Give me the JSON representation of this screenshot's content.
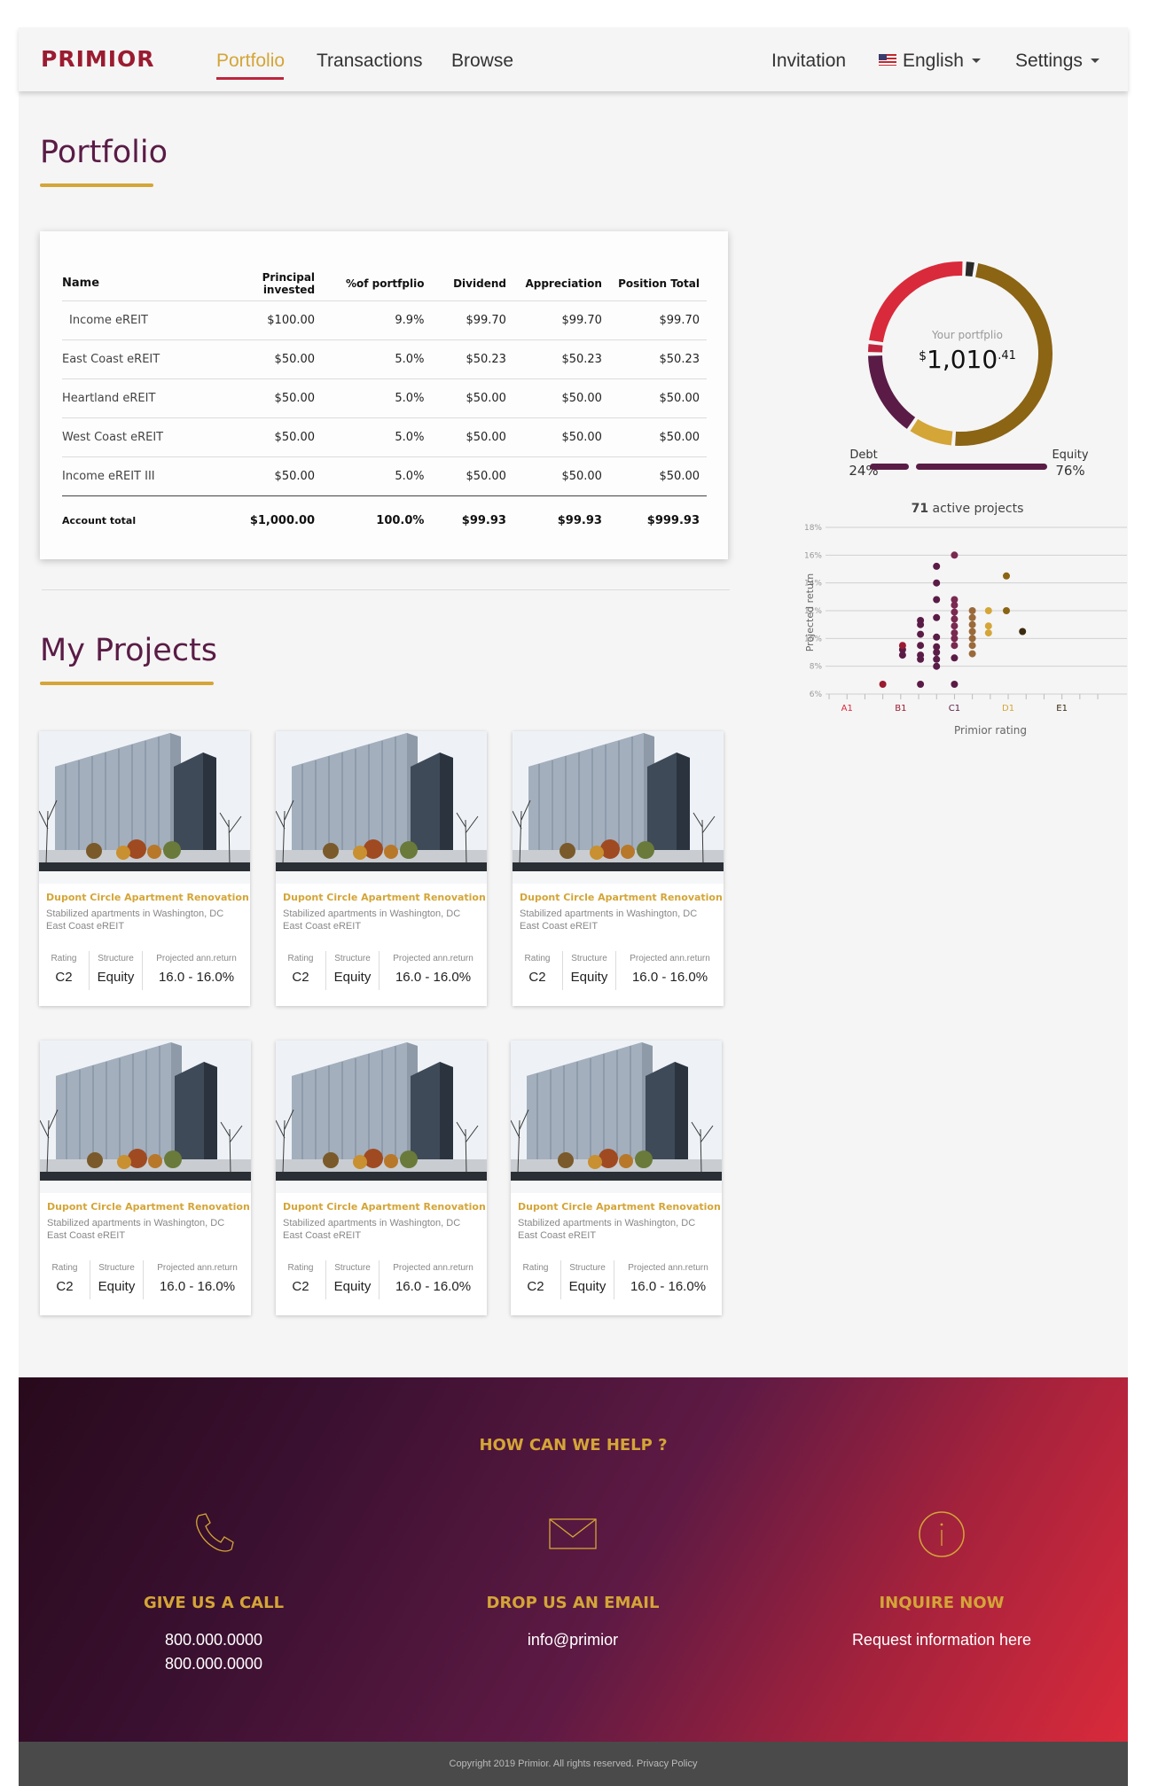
{
  "nav": {
    "logo": "PRIMIOR",
    "links": [
      "Portfolio",
      "Transactions",
      "Browse"
    ],
    "invitation": "Invitation",
    "language": "English",
    "settings": "Settings"
  },
  "portfolio": {
    "title": "Portfolio",
    "columns": [
      "Name",
      "Principal invested",
      "%of portfplio",
      "Dividend",
      "Appreciation",
      "Position Total"
    ],
    "rows": [
      [
        "Income eREIT",
        "$100.00",
        "9.9%",
        "$99.70",
        "$99.70",
        "$99.70"
      ],
      [
        "East Coast eREIT",
        "$50.00",
        "5.0%",
        "$50.23",
        "$50.23",
        "$50.23"
      ],
      [
        "Heartland eREIT",
        "$50.00",
        "5.0%",
        "$50.00",
        "$50.00",
        "$50.00"
      ],
      [
        "West Coast eREIT",
        "$50.00",
        "5.0%",
        "$50.00",
        "$50.00",
        "$50.00"
      ],
      [
        "Income eREIT III",
        "$50.00",
        "5.0%",
        "$50.00",
        "$50.00",
        "$50.00"
      ]
    ],
    "total": [
      "Account total",
      "$1,000.00",
      "100.0%",
      "$99.93",
      "$99.93",
      "$999.93"
    ]
  },
  "summary": {
    "label": "Your portfplio",
    "dollar_sign": "$",
    "amount": "1,010",
    "cents": ".41",
    "debt_label": "Debt",
    "debt_pct": "24%",
    "equity_label": "Equity",
    "equity_pct": "76%",
    "active_count": "71",
    "active_text": "active projects"
  },
  "projects": {
    "title": "My Projects",
    "cards": [
      {
        "title": "Dupont Circle Apartment Renovation",
        "desc": "Stabilized apartments in Washington, DC East Coast eREIT",
        "rating_label": "Rating",
        "rating": "C2",
        "structure_label": "Structure",
        "structure": "Equity",
        "return_label": "Projected ann.return",
        "return": "16.0 - 16.0%"
      },
      {
        "title": "Dupont Circle Apartment Renovation",
        "desc": "Stabilized apartments in Washington, DC East Coast eREIT",
        "rating_label": "Rating",
        "rating": "C2",
        "structure_label": "Structure",
        "structure": "Equity",
        "return_label": "Projected ann.return",
        "return": "16.0 - 16.0%"
      },
      {
        "title": "Dupont Circle Apartment Renovation",
        "desc": "Stabilized apartments in Washington, DC East Coast eREIT",
        "rating_label": "Rating",
        "rating": "C2",
        "structure_label": "Structure",
        "structure": "Equity",
        "return_label": "Projected ann.return",
        "return": "16.0 - 16.0%"
      },
      {
        "title": "Dupont Circle Apartment Renovation",
        "desc": "Stabilized apartments in Washington, DC East Coast eREIT",
        "rating_label": "Rating",
        "rating": "C2",
        "structure_label": "Structure",
        "structure": "Equity",
        "return_label": "Projected ann.return",
        "return": "16.0 - 16.0%"
      },
      {
        "title": "Dupont Circle Apartment Renovation",
        "desc": "Stabilized apartments in Washington, DC East Coast eREIT",
        "rating_label": "Rating",
        "rating": "C2",
        "structure_label": "Structure",
        "structure": "Equity",
        "return_label": "Projected ann.return",
        "return": "16.0 - 16.0%"
      },
      {
        "title": "Dupont Circle Apartment Renovation",
        "desc": "Stabilized apartments in Washington, DC East Coast eREIT",
        "rating_label": "Rating",
        "rating": "C2",
        "structure_label": "Structure",
        "structure": "Equity",
        "return_label": "Projected ann.return",
        "return": "16.0 - 16.0%"
      }
    ]
  },
  "footer": {
    "heading": "HOW CAN WE HELP ?",
    "call_title": "GIVE US A CALL",
    "phone1": "800.000.0000",
    "phone2": "800.000.0000",
    "email_title": "DROP US AN EMAIL",
    "email": "info@primior",
    "inquire_title": "INQUIRE NOW",
    "inquire_text": "Request information here",
    "copyright": "Copyright 2019 Primior. All rights reserved. Privacy Policy"
  },
  "colors": {
    "brand": "#9b1b30",
    "gold": "#d4a537",
    "plum": "#5a1c46",
    "red": "#d92a3b",
    "brown": "#8b6414",
    "dark": "#2a2a2a"
  },
  "chart_data": [
    {
      "type": "pie",
      "variant": "donut",
      "slices": [
        {
          "color": "#8b6414",
          "value": 47
        },
        {
          "color": "#d4a537",
          "value": 8
        },
        {
          "color": "#5a1c46",
          "value": 15
        },
        {
          "color": "#c0253e",
          "value": 2
        },
        {
          "color": "#d92a3b",
          "value": 23
        },
        {
          "color": "#2a2a2a",
          "value": 2
        }
      ]
    },
    {
      "type": "bar",
      "orientation": "horizontal",
      "categories": [
        "Debt",
        "Equity"
      ],
      "values": [
        24,
        76
      ]
    },
    {
      "type": "scatter",
      "title": "71 active projects",
      "xlabel": "Primior rating",
      "ylabel": "Projected return",
      "x_ticks": [
        "A1",
        "B1",
        "C1",
        "D1",
        "E1"
      ],
      "y_ticks": [
        "6%",
        "8%",
        "10%",
        "12%",
        "14%",
        "16%",
        "18%"
      ],
      "ylim": [
        6,
        18
      ],
      "grid": true,
      "points": [
        {
          "x": 3.2,
          "y": 6.7,
          "color": "#9b1b30"
        },
        {
          "x": 5.3,
          "y": 6.7,
          "color": "#5a1c46"
        },
        {
          "x": 7.2,
          "y": 6.7,
          "color": "#5a1c46"
        },
        {
          "x": 4.3,
          "y": 8.8,
          "color": "#5a1c46"
        },
        {
          "x": 4.3,
          "y": 9.2,
          "color": "#5a1c46"
        },
        {
          "x": 4.3,
          "y": 9.5,
          "color": "#9b1b30"
        },
        {
          "x": 5.3,
          "y": 8.5,
          "color": "#5a1c46"
        },
        {
          "x": 5.3,
          "y": 8.8,
          "color": "#5a1c46"
        },
        {
          "x": 5.3,
          "y": 9.5,
          "color": "#5a1c46"
        },
        {
          "x": 5.3,
          "y": 10.3,
          "color": "#5a1c46"
        },
        {
          "x": 5.3,
          "y": 11.0,
          "color": "#5a1c46"
        },
        {
          "x": 5.3,
          "y": 11.3,
          "color": "#5a1c46"
        },
        {
          "x": 6.2,
          "y": 8.0,
          "color": "#5a1c46"
        },
        {
          "x": 6.2,
          "y": 8.5,
          "color": "#5a1c46"
        },
        {
          "x": 6.2,
          "y": 9.0,
          "color": "#5a1c46"
        },
        {
          "x": 6.2,
          "y": 9.4,
          "color": "#5a1c46"
        },
        {
          "x": 6.2,
          "y": 10.1,
          "color": "#5a1c46"
        },
        {
          "x": 6.2,
          "y": 11.5,
          "color": "#5a1c46"
        },
        {
          "x": 6.2,
          "y": 12.8,
          "color": "#5a1c46"
        },
        {
          "x": 6.2,
          "y": 14.0,
          "color": "#5a1c46"
        },
        {
          "x": 6.2,
          "y": 15.2,
          "color": "#5a1c46"
        },
        {
          "x": 7.2,
          "y": 8.6,
          "color": "#5a1c46"
        },
        {
          "x": 7.2,
          "y": 9.5,
          "color": "#7a2950"
        },
        {
          "x": 7.2,
          "y": 10.0,
          "color": "#7a2950"
        },
        {
          "x": 7.2,
          "y": 10.4,
          "color": "#7a2950"
        },
        {
          "x": 7.2,
          "y": 10.9,
          "color": "#7a2950"
        },
        {
          "x": 7.2,
          "y": 11.4,
          "color": "#7a2950"
        },
        {
          "x": 7.2,
          "y": 11.9,
          "color": "#7a2950"
        },
        {
          "x": 7.2,
          "y": 12.4,
          "color": "#7a2950"
        },
        {
          "x": 7.2,
          "y": 12.8,
          "color": "#7a2950"
        },
        {
          "x": 7.2,
          "y": 16.0,
          "color": "#7a2950"
        },
        {
          "x": 8.2,
          "y": 9.5,
          "color": "#9a6a3a"
        },
        {
          "x": 8.2,
          "y": 10.0,
          "color": "#9a6a3a"
        },
        {
          "x": 8.2,
          "y": 10.5,
          "color": "#9a6a3a"
        },
        {
          "x": 8.2,
          "y": 11.0,
          "color": "#9a6a3a"
        },
        {
          "x": 8.2,
          "y": 11.5,
          "color": "#9a6a3a"
        },
        {
          "x": 8.2,
          "y": 12.0,
          "color": "#9a6a3a"
        },
        {
          "x": 8.2,
          "y": 8.9,
          "color": "#9a6a3a"
        },
        {
          "x": 9.1,
          "y": 10.4,
          "color": "#d4a537"
        },
        {
          "x": 9.1,
          "y": 10.9,
          "color": "#d4a537"
        },
        {
          "x": 9.1,
          "y": 12.0,
          "color": "#d4a537"
        },
        {
          "x": 10.1,
          "y": 12.0,
          "color": "#8b6414"
        },
        {
          "x": 10.1,
          "y": 14.5,
          "color": "#8b6414"
        },
        {
          "x": 11.0,
          "y": 10.5,
          "color": "#3a2a10"
        }
      ]
    }
  ]
}
